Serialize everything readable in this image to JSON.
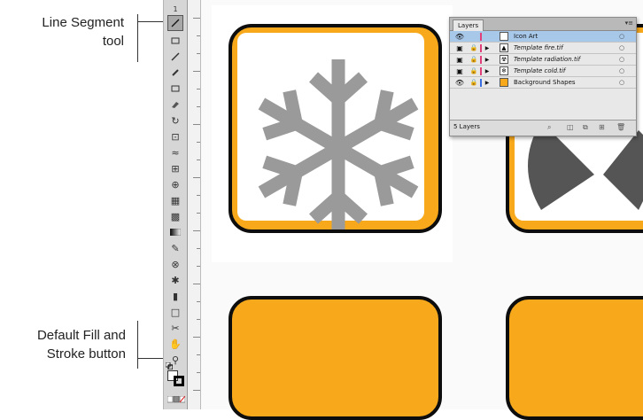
{
  "callouts": {
    "line_segment_line1": "Line Segment",
    "line_segment_line2": "tool",
    "default_fill_line1": "Default Fill and",
    "default_fill_line2": "Stroke button"
  },
  "toolbox": {
    "tools": [
      "line-segment",
      "rectangle",
      "paintbrush",
      "pencil",
      "blob-brush",
      "eraser",
      "rotate",
      "scale",
      "warp",
      "free-transform",
      "shape-builder",
      "perspective-grid",
      "mesh",
      "gradient",
      "eyedropper",
      "blend",
      "symbol-sprayer",
      "column-graph",
      "artboard",
      "slice",
      "hand",
      "zoom"
    ],
    "ruler_label": "1"
  },
  "layers_panel": {
    "tab_label": "Layers",
    "layers": [
      {
        "name": "Icon Art",
        "color": "#e0407a",
        "active": true
      },
      {
        "name": "Template fire.tif",
        "color": "#e0407a",
        "active": false
      },
      {
        "name": "Template radiation.tif",
        "color": "#e0407a",
        "active": false
      },
      {
        "name": "Template cold.tif",
        "color": "#e0407a",
        "active": false
      },
      {
        "name": "Background Shapes",
        "color": "#3a6ee0",
        "active": false
      }
    ],
    "layer_count": "5 Layers"
  },
  "colors": {
    "tile_orange": "#f7a81b",
    "snowflake_gray": "#999999",
    "tile_border": "#0d0d0d"
  }
}
